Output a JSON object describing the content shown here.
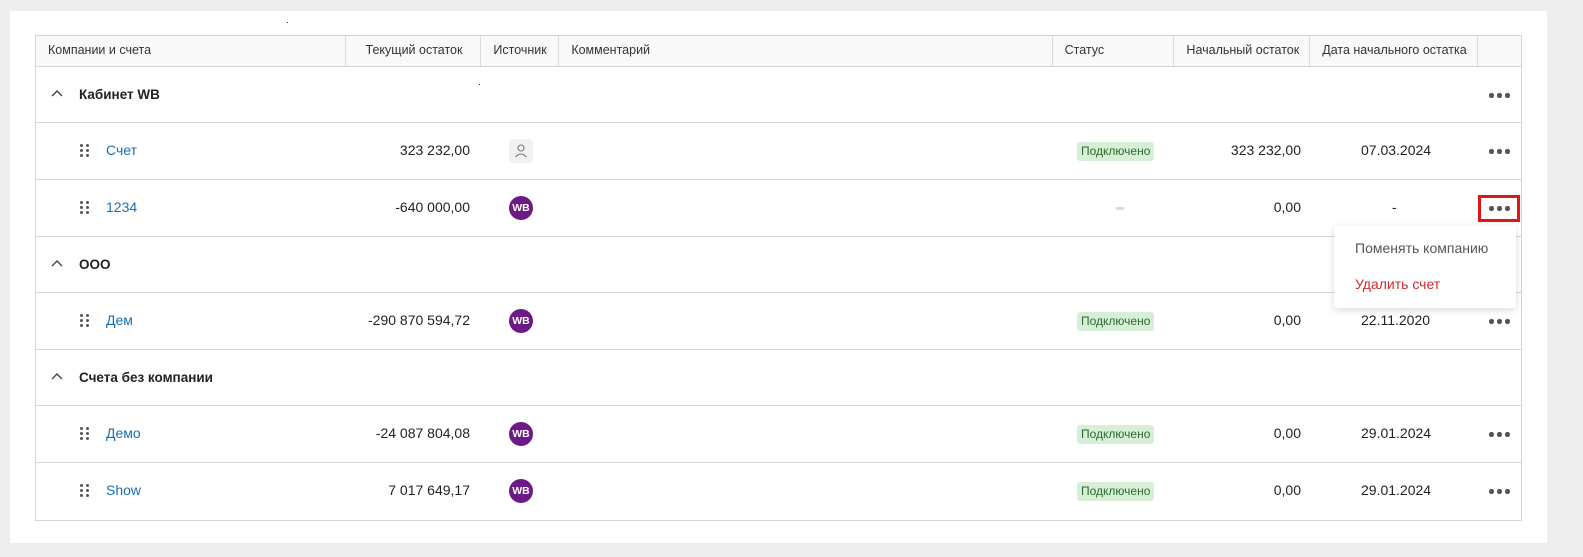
{
  "headers": {
    "companies": "Компании и счета",
    "balance": "Текущий остаток",
    "source": "Источник",
    "comment": "Комментарий",
    "status": "Статус",
    "initial": "Начальный остаток",
    "date": "Дата начального остатка"
  },
  "groups": [
    {
      "title": "Кабинет WB",
      "accounts": [
        {
          "name": "Счет",
          "balance": "323 232,00",
          "source": "user-icon",
          "status": "Подключено",
          "initial": "323 232,00",
          "date": "07.03.2024"
        },
        {
          "name": "1234",
          "balance": "-640 000,00",
          "source": "WB",
          "status": "",
          "initial": "0,00",
          "date": "-"
        }
      ]
    },
    {
      "title": "ООО",
      "accounts": [
        {
          "name": "Дем",
          "balance": "-290 870 594,72",
          "source": "WB",
          "status": "Подключено",
          "initial": "0,00",
          "date": "22.11.2020"
        }
      ]
    },
    {
      "title": "Счета без компании",
      "accounts": [
        {
          "name": "Демо",
          "balance": "-24 087 804,08",
          "source": "WB",
          "status": "Подключено",
          "initial": "0,00",
          "date": "29.01.2024"
        },
        {
          "name": "Show",
          "balance": "7 017 649,17",
          "source": "WB",
          "status": "Подключено",
          "initial": "0,00",
          "date": "29.01.2024"
        }
      ]
    }
  ],
  "context_menu": {
    "change_company": "Поменять компанию",
    "delete_account": "Удалить счет"
  },
  "colors": {
    "link": "#1a6fb5",
    "status_bg": "#d8efd7",
    "wb_badge": "#6d1a87",
    "danger": "#d22828",
    "highlight": "#e01616"
  }
}
